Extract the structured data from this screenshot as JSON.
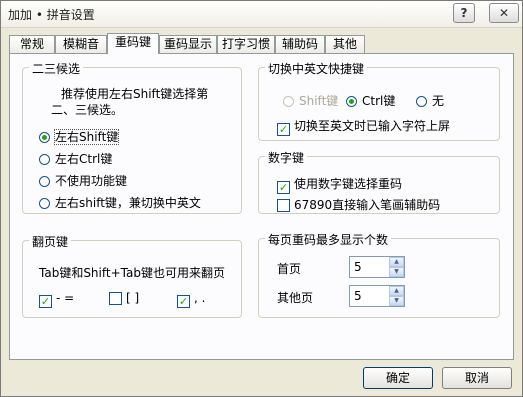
{
  "window": {
    "title": "加加 • 拼音设置"
  },
  "titlebar": {
    "help": "?",
    "close": "✕"
  },
  "tabs": [
    {
      "label": "常规"
    },
    {
      "label": "模糊音"
    },
    {
      "label": "重码键"
    },
    {
      "label": "重码显示"
    },
    {
      "label": "打字习惯"
    },
    {
      "label": "辅助码"
    },
    {
      "label": "其他"
    }
  ],
  "group23": {
    "title": "二三候选",
    "description_line1": "推荐使用左右Shift键选择第",
    "description_line2": "二、三候选。",
    "options": [
      {
        "label": "左右Shift键",
        "selected": true
      },
      {
        "label": "左右Ctrl键",
        "selected": false
      },
      {
        "label": "不使用功能键",
        "selected": false
      },
      {
        "label": "左右shift键，兼切换中英文",
        "selected": false
      }
    ]
  },
  "switchGroup": {
    "title": "切换中英文快捷键",
    "options": [
      {
        "label": "Shift键",
        "selected": false,
        "disabled": true
      },
      {
        "label": "Ctrl键",
        "selected": true,
        "disabled": false
      },
      {
        "label": "无",
        "selected": false,
        "disabled": false
      }
    ],
    "checkbox": {
      "label": "切换至英文时已输入字符上屏",
      "checked": true
    }
  },
  "numberGroup": {
    "title": "数字键",
    "checkboxes": [
      {
        "label": "使用数字键选择重码",
        "checked": true
      },
      {
        "label": "67890直接输入笔画辅助码",
        "checked": false
      }
    ]
  },
  "pageGroup": {
    "title": "翻页键",
    "description": "Tab键和Shift+Tab键也可用来翻页",
    "checkboxes": [
      {
        "label": "-  =",
        "checked": true
      },
      {
        "label": "[  ]",
        "checked": false
      },
      {
        "label": ",  .",
        "checked": true
      }
    ]
  },
  "maxGroup": {
    "title": "每页重码最多显示个数",
    "first_label": "首页",
    "first_value": "5",
    "other_label": "其他页",
    "other_value": "5"
  },
  "footer": {
    "ok": "确定",
    "cancel": "取消"
  },
  "check_mark": "✓"
}
